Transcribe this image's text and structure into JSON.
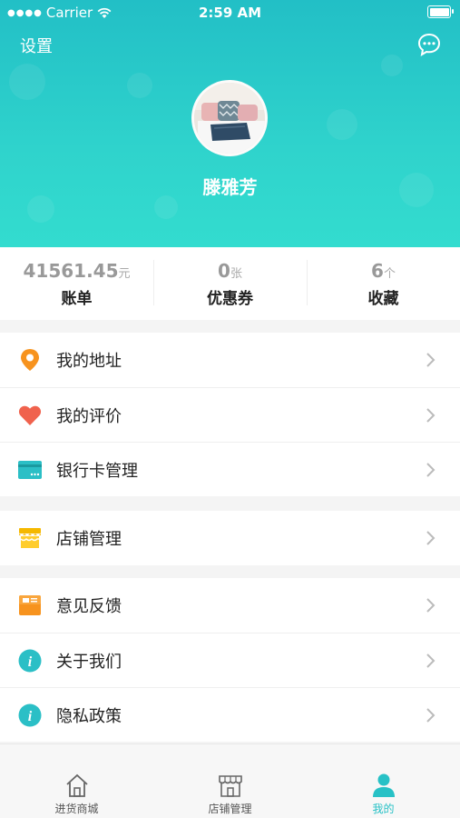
{
  "status": {
    "carrier": "Carrier",
    "time": "2:59 AM"
  },
  "header": {
    "settings_label": "设置",
    "username": "滕雅芳"
  },
  "stats": [
    {
      "value": "41561.45",
      "unit": "元",
      "label": "账单"
    },
    {
      "value": "0",
      "unit": "张",
      "label": "优惠券"
    },
    {
      "value": "6",
      "unit": "个",
      "label": "收藏"
    }
  ],
  "menu": {
    "address": "我的地址",
    "review": "我的评价",
    "bankcard": "银行卡管理",
    "store": "店铺管理",
    "feedback": "意见反馈",
    "about": "关于我们",
    "privacy": "隐私政策"
  },
  "tabbar": {
    "mall": "进货商城",
    "store": "店铺管理",
    "mine": "我的"
  },
  "colors": {
    "accent": "#27c1c6",
    "orange": "#f7931e",
    "heart": "#f0624d",
    "card": "#2bbfc6",
    "store": "#f5b800"
  }
}
